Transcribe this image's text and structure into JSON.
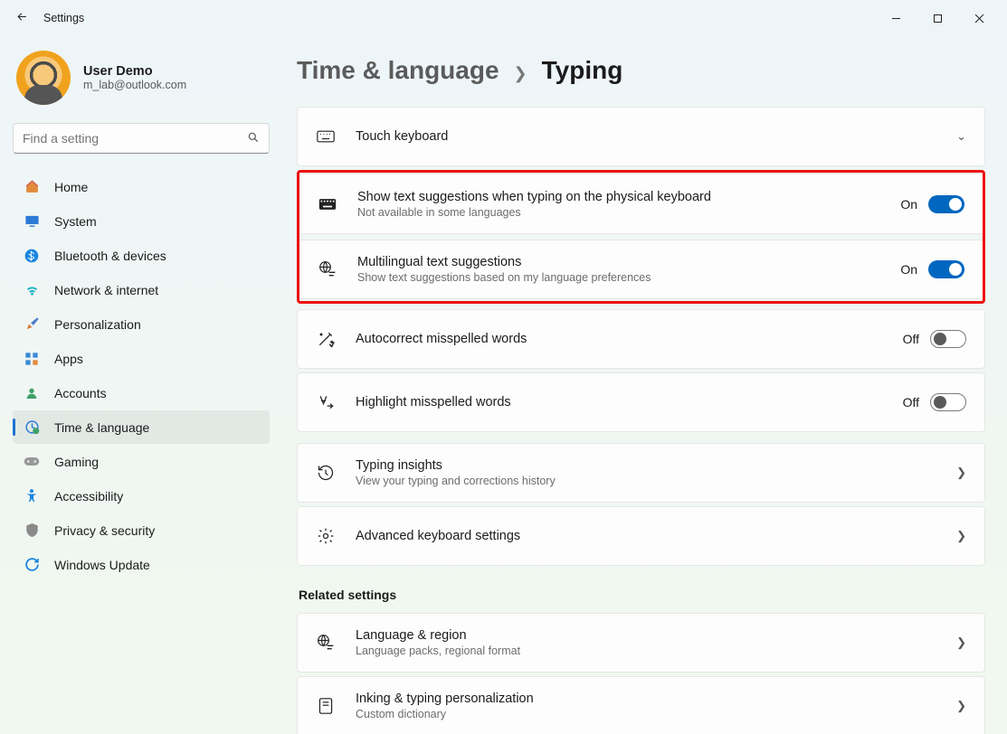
{
  "window": {
    "title": "Settings"
  },
  "user": {
    "name": "User Demo",
    "email": "m_lab@outlook.com"
  },
  "search": {
    "placeholder": "Find a setting"
  },
  "nav": {
    "home": "Home",
    "system": "System",
    "bluetooth": "Bluetooth & devices",
    "network": "Network & internet",
    "personalization": "Personalization",
    "apps": "Apps",
    "accounts": "Accounts",
    "time": "Time & language",
    "gaming": "Gaming",
    "accessibility": "Accessibility",
    "privacy": "Privacy & security",
    "update": "Windows Update"
  },
  "breadcrumb": {
    "parent": "Time & language",
    "current": "Typing"
  },
  "settings": {
    "touch_keyboard": {
      "title": "Touch keyboard"
    },
    "physical_suggestions": {
      "title": "Show text suggestions when typing on the physical keyboard",
      "sub": "Not available in some languages",
      "state": "On"
    },
    "multilingual": {
      "title": "Multilingual text suggestions",
      "sub": "Show text suggestions based on my language preferences",
      "state": "On"
    },
    "autocorrect": {
      "title": "Autocorrect misspelled words",
      "state": "Off"
    },
    "highlight_misspelled": {
      "title": "Highlight misspelled words",
      "state": "Off"
    },
    "typing_insights": {
      "title": "Typing insights",
      "sub": "View your typing and corrections history"
    },
    "advanced": {
      "title": "Advanced keyboard settings"
    }
  },
  "related": {
    "heading": "Related settings",
    "language_region": {
      "title": "Language & region",
      "sub": "Language packs, regional format"
    },
    "inking": {
      "title": "Inking & typing personalization",
      "sub": "Custom dictionary"
    }
  }
}
